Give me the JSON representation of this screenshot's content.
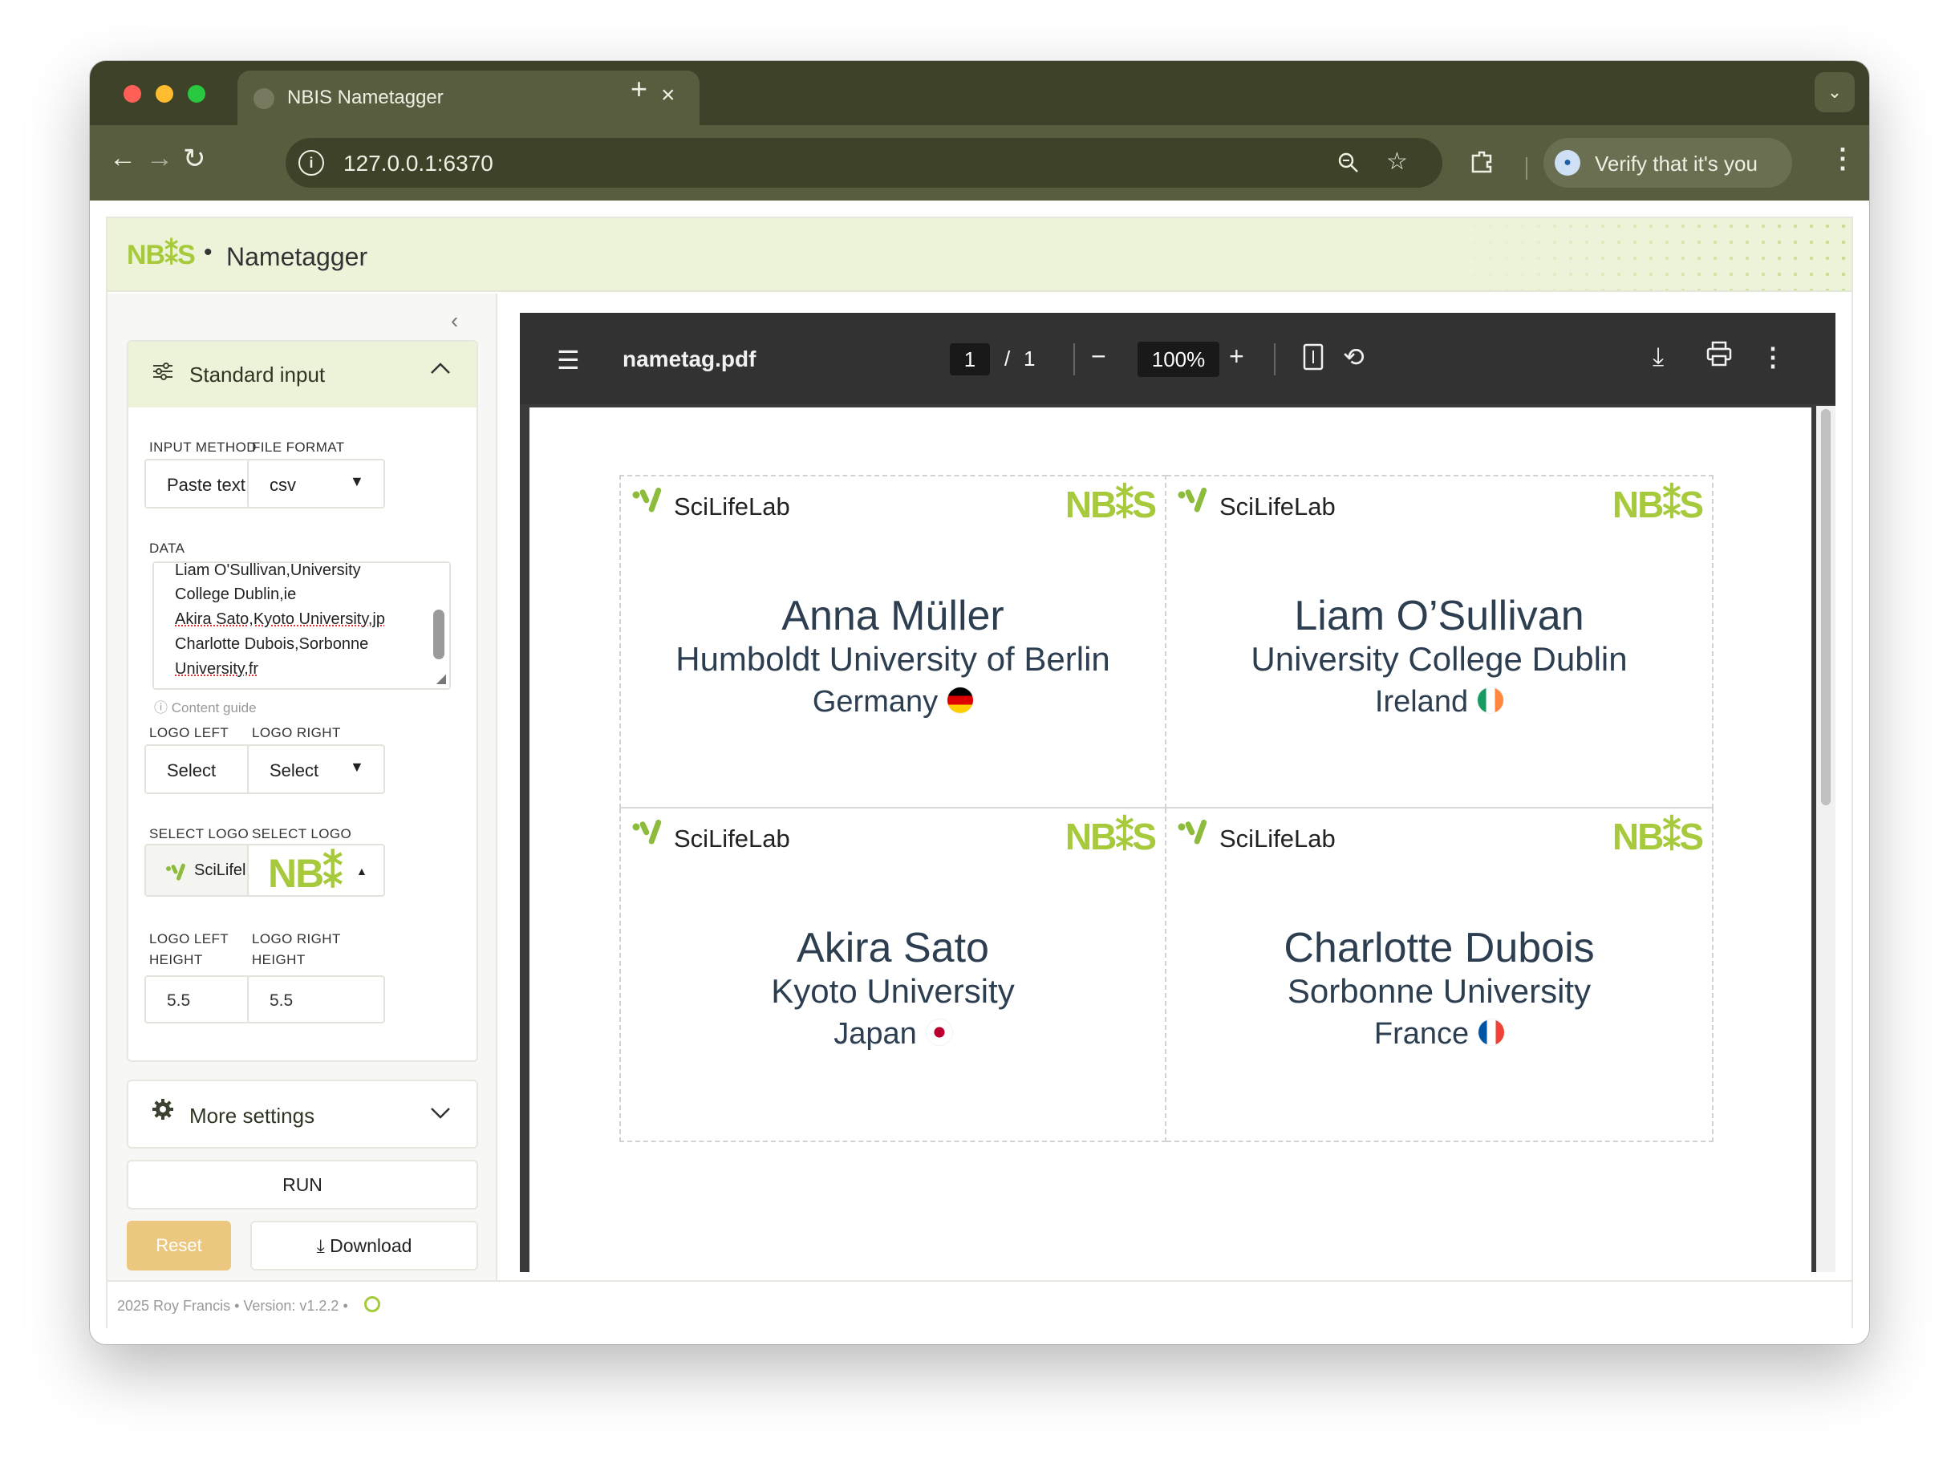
{
  "browser": {
    "tab_title": "NBIS Nametagger",
    "tab_close": "×",
    "new_tab": "+",
    "tab_menu": "⌄",
    "url": "127.0.0.1:6370",
    "verify_label": "Verify that it's you",
    "back": "←",
    "forward": "→",
    "reload": "↻",
    "zoom_icon": "🔍",
    "star_icon": "☆",
    "ext_icon": "⧉",
    "menu": "⋮"
  },
  "app": {
    "brand": "NB⁑S",
    "separator": "•",
    "title": "Nametagger",
    "colors": {
      "accent": "#a7c93c",
      "header_bg": "#ecf3d9",
      "reset": "#ecc780"
    }
  },
  "sidebar": {
    "collapse": "‹",
    "standard_input": {
      "title": "Standard input",
      "input_method_label": "INPUT METHOD",
      "input_method_value": "Paste text",
      "file_format_label": "FILE FORMAT",
      "file_format_value": "csv",
      "data_label": "DATA",
      "data_lines": [
        "Liam O'Sullivan,University",
        "College Dublin,ie",
        "Akira Sato,Kyoto University,jp",
        "Charlotte Dubois,Sorbonne",
        "University,fr"
      ],
      "content_guide": "Content guide",
      "logo_left_label": "LOGO LEFT",
      "logo_left_value": "Select",
      "logo_right_label": "LOGO RIGHT",
      "logo_right_value": "Select",
      "select_logo_left_label": "SELECT LOGO",
      "select_logo_left_value": "SciLifel",
      "select_logo_right_label": "SELECT LOGO",
      "select_logo_right_value": "NB⁑",
      "logo_left_height_label": "LOGO LEFT HEIGHT",
      "logo_left_height": "5.5",
      "logo_right_height_label": "LOGO RIGHT HEIGHT",
      "logo_right_height": "5.5"
    },
    "more_settings": "More settings",
    "run": "RUN",
    "reset": "Reset",
    "download": "Download"
  },
  "footer": {
    "text": "2025 Roy Francis • Version: v1.2.2 •"
  },
  "pdf": {
    "filename": "nametag.pdf",
    "page": "1",
    "slash": "/",
    "total": "1",
    "zoom": "100%",
    "minus": "−",
    "plus": "+",
    "menu_icon": "☰",
    "fit_icon": "▯",
    "rotate_icon": "⟲",
    "download_icon": "⤓",
    "print_icon": "⎙",
    "more_icon": "⋮",
    "left_logo_text": "SciLifeLab",
    "right_logo_text": "NB⁑S",
    "cards": [
      {
        "name": "Anna Müller",
        "institution": "Humboldt University of Berlin",
        "country": "Germany",
        "flag": "flag-de-icon"
      },
      {
        "name": "Liam O’Sullivan",
        "institution": "University College Dublin",
        "country": "Ireland",
        "flag": "flag-ie-icon"
      },
      {
        "name": "Akira Sato",
        "institution": "Kyoto University",
        "country": "Japan",
        "flag": "flag-jp-icon"
      },
      {
        "name": "Charlotte Dubois",
        "institution": "Sorbonne University",
        "country": "France",
        "flag": "flag-fr-icon"
      }
    ]
  }
}
